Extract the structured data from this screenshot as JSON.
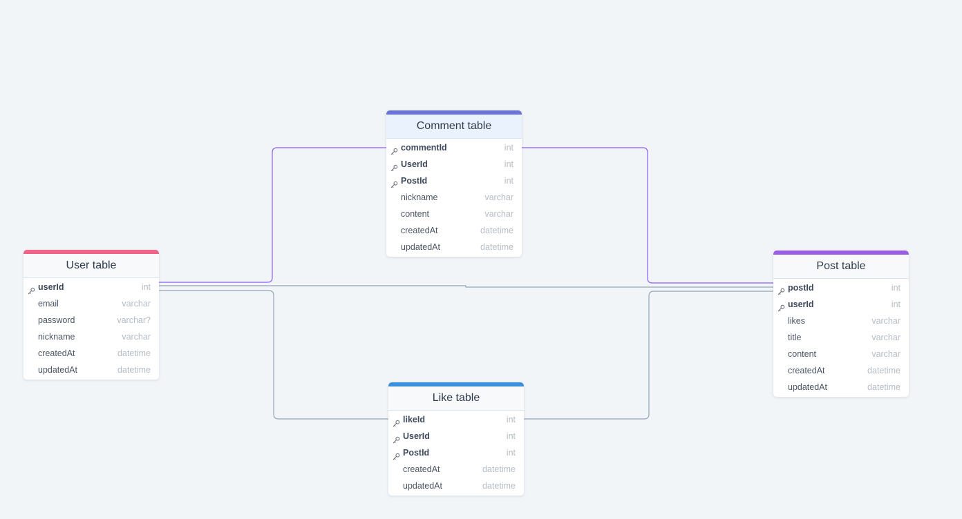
{
  "diagram": {
    "tables": [
      {
        "id": "user",
        "title": "User table",
        "accent": "#f0648a",
        "fields": [
          {
            "name": "userId",
            "type": "int",
            "key": true
          },
          {
            "name": "email",
            "type": "varchar",
            "key": false
          },
          {
            "name": "password",
            "type": "varchar?",
            "key": false
          },
          {
            "name": "nickname",
            "type": "varchar",
            "key": false
          },
          {
            "name": "createdAt",
            "type": "datetime",
            "key": false
          },
          {
            "name": "updatedAt",
            "type": "datetime",
            "key": false
          }
        ]
      },
      {
        "id": "comment",
        "title": "Comment table",
        "accent": "#6a74d4",
        "fields": [
          {
            "name": "commentId",
            "type": "int",
            "key": true
          },
          {
            "name": "UserId",
            "type": "int",
            "key": true
          },
          {
            "name": "PostId",
            "type": "int",
            "key": true
          },
          {
            "name": "nickname",
            "type": "varchar",
            "key": false
          },
          {
            "name": "content",
            "type": "varchar",
            "key": false
          },
          {
            "name": "createdAt",
            "type": "datetime",
            "key": false
          },
          {
            "name": "updatedAt",
            "type": "datetime",
            "key": false
          }
        ]
      },
      {
        "id": "post",
        "title": "Post table",
        "accent": "#9b5de5",
        "fields": [
          {
            "name": "postId",
            "type": "int",
            "key": true
          },
          {
            "name": "userId",
            "type": "int",
            "key": true
          },
          {
            "name": "likes",
            "type": "varchar",
            "key": false
          },
          {
            "name": "title",
            "type": "varchar",
            "key": false
          },
          {
            "name": "content",
            "type": "varchar",
            "key": false
          },
          {
            "name": "createdAt",
            "type": "datetime",
            "key": false
          },
          {
            "name": "updatedAt",
            "type": "datetime",
            "key": false
          }
        ]
      },
      {
        "id": "like",
        "title": "Like table",
        "accent": "#3b8fdb",
        "fields": [
          {
            "name": "likeId",
            "type": "int",
            "key": true
          },
          {
            "name": "UserId",
            "type": "int",
            "key": true
          },
          {
            "name": "PostId",
            "type": "int",
            "key": true
          },
          {
            "name": "createdAt",
            "type": "datetime",
            "key": false
          },
          {
            "name": "updatedAt",
            "type": "datetime",
            "key": false
          }
        ]
      }
    ],
    "relationships": [
      {
        "from": "user.userId",
        "to": "comment.UserId",
        "color": "#8b5cf6"
      },
      {
        "from": "user.userId",
        "to": "post.userId",
        "color": "#94a3b8"
      },
      {
        "from": "user.userId",
        "to": "like.UserId",
        "color": "#94a3b8"
      },
      {
        "from": "post.postId",
        "to": "comment.PostId",
        "color": "#8b5cf6"
      },
      {
        "from": "post.postId",
        "to": "like.PostId",
        "color": "#94a3b8"
      }
    ]
  }
}
